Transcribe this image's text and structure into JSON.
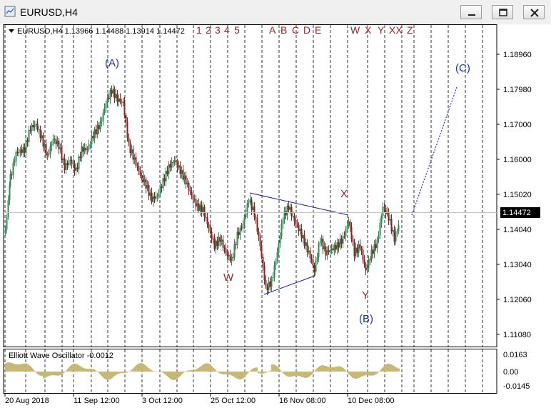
{
  "window": {
    "title": "EURUSD,H4",
    "buttons": [
      "minimize",
      "restore",
      "close"
    ]
  },
  "chart": {
    "info": "EURUSD,H4  1.13966 1.14488 1.13914 1.14472",
    "current_price": "1.14472",
    "price_ticks": [
      "1.18960",
      "1.17980",
      "1.17000",
      "1.16000",
      "1.15020",
      "1.14040",
      "1.13040",
      "1.12060",
      "1.11080"
    ],
    "date_ticks": [
      "20 Aug 2018",
      "11 Sep 12:00",
      "3 Oct 12:00",
      "25 Oct 12:00",
      "16 Nov 08:00",
      "10 Dec 08:00"
    ],
    "top_count_labels": {
      "impulse": [
        "1",
        "2",
        "3",
        "4",
        "5"
      ],
      "corrective": [
        "A",
        "B",
        "C",
        "D",
        "E"
      ],
      "complex": [
        "W",
        "X",
        "Y",
        "XX",
        "Z"
      ]
    },
    "wave_labels": {
      "A": "(A)",
      "B": "(B)",
      "C": "(C)",
      "W": "W",
      "X": "X",
      "Y": "Y"
    },
    "colors": {
      "up_candle": "#2e8b57",
      "down_candle": "#8b2323",
      "wave_blue": "#1a2fbf",
      "wave_red": "#a02020",
      "triangle_line": "#1a1aa0",
      "osc_bar": "#c8b878"
    }
  },
  "oscillator": {
    "label": "Elliott Wave Oscillator -0.0012",
    "ticks": [
      "0.0163",
      "0.00",
      "-0.0145"
    ]
  }
}
